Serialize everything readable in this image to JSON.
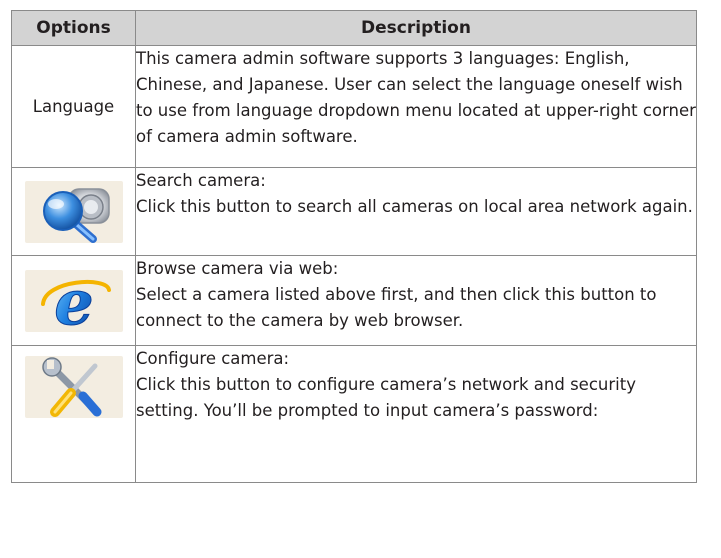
{
  "table": {
    "headers": {
      "options": "Options",
      "description": "Description"
    },
    "rows": [
      {
        "option_text": "Language",
        "description": "This camera admin software supports 3 languages: English, Chinese, and Japanese. User can select the language oneself wish to use from language dropdown menu located at upper-right corner of camera admin software."
      },
      {
        "icon": "search-camera-icon",
        "description": "Search camera:\nClick this button to search all cameras on local area network again."
      },
      {
        "icon": "internet-explorer-icon",
        "description": "Browse camera via web:\nSelect a camera listed above first, and then click this button to connect to the camera by web browser."
      },
      {
        "icon": "configure-tools-icon",
        "description": "Configure camera:\nClick this button to configure camera’s network and security setting. You’ll be prompted to input camera’s password:"
      }
    ]
  }
}
